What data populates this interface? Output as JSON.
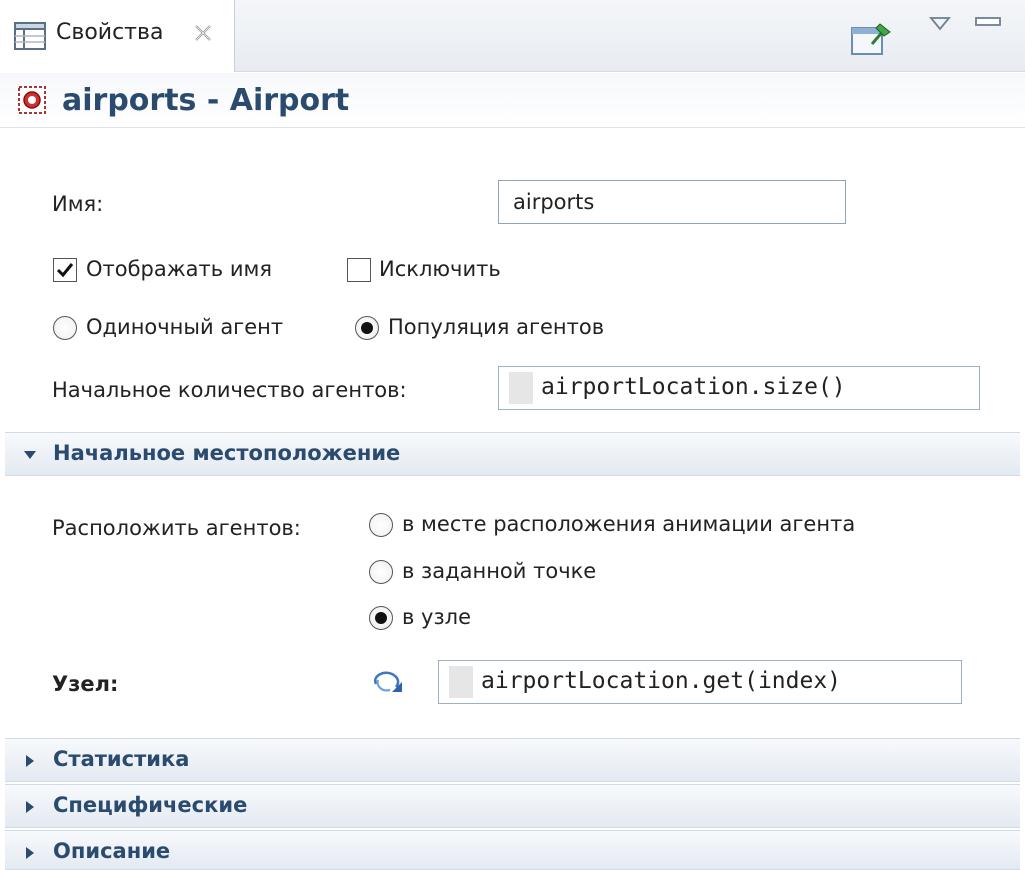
{
  "tab": {
    "label": "Свойства",
    "icon": "properties-table-icon",
    "close_icon": "close-icon"
  },
  "toolbar": {
    "pin_icon": "pin-view-icon",
    "menu_icon": "view-menu-icon",
    "minimize_icon": "minimize-icon"
  },
  "header": {
    "icon": "agent-population-icon",
    "title": "airports - Airport"
  },
  "general": {
    "name_label": "Имя:",
    "name_value": "airports",
    "show_name_label": "Отображать имя",
    "show_name_checked": true,
    "exclude_label": "Исключить",
    "exclude_checked": false,
    "single_agent_label": "Одиночный агент",
    "population_label": "Популяция агентов",
    "selected_mode": "population",
    "initial_count_label": "Начальное количество агентов:",
    "initial_count_value": "airportLocation.size()"
  },
  "initial_location": {
    "section_label": "Начальное местоположение",
    "expanded": true,
    "place_label": "Расположить агентов:",
    "options": [
      "в месте расположения анимации агента",
      "в заданной точке",
      "в узле"
    ],
    "selected_option": "в узле",
    "node_label": "Узел:",
    "node_value": "airportLocation.get(index)",
    "node_icon": "dynamic-value-icon"
  },
  "collapsed_sections": [
    "Статистика",
    "Специфические",
    "Описание"
  ],
  "colors": {
    "section_title": "#2a4a6e",
    "header_bg": "#e4eaf2",
    "input_border": "#8fa5bd"
  }
}
